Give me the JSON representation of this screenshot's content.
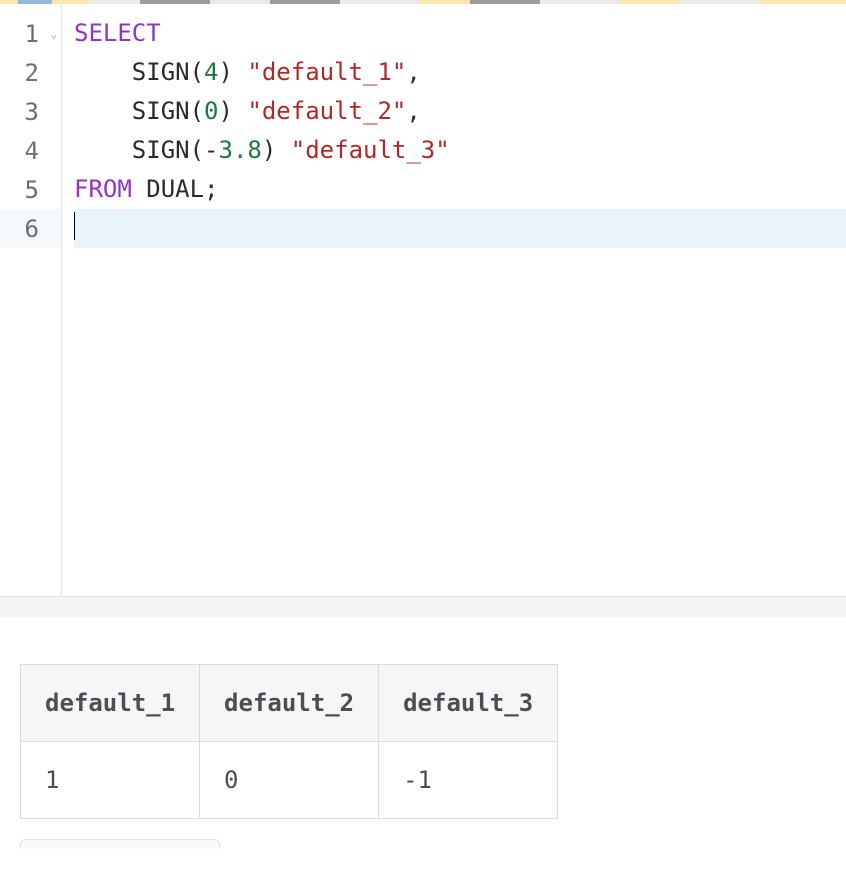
{
  "editor": {
    "lines": [
      {
        "n": "1",
        "foldable": true
      },
      {
        "n": "2",
        "foldable": false
      },
      {
        "n": "3",
        "foldable": false
      },
      {
        "n": "4",
        "foldable": false
      },
      {
        "n": "5",
        "foldable": false
      },
      {
        "n": "6",
        "foldable": false
      }
    ],
    "code": {
      "l1_select": "SELECT",
      "l2_fn": "SIGN",
      "l2_arg": "4",
      "l2_alias": "\"default_1\"",
      "l3_fn": "SIGN",
      "l3_arg": "0",
      "l3_alias": "\"default_2\"",
      "l4_fn": "SIGN",
      "l4_neg": "-",
      "l4_arg": "3.8",
      "l4_alias": "\"default_3\"",
      "l5_from": "FROM",
      "l5_tbl": "DUAL",
      "l5_semi": ";"
    }
  },
  "results": {
    "columns": [
      "default_1",
      "default_2",
      "default_3"
    ],
    "rows": [
      [
        "1",
        "0",
        "-1"
      ]
    ]
  }
}
